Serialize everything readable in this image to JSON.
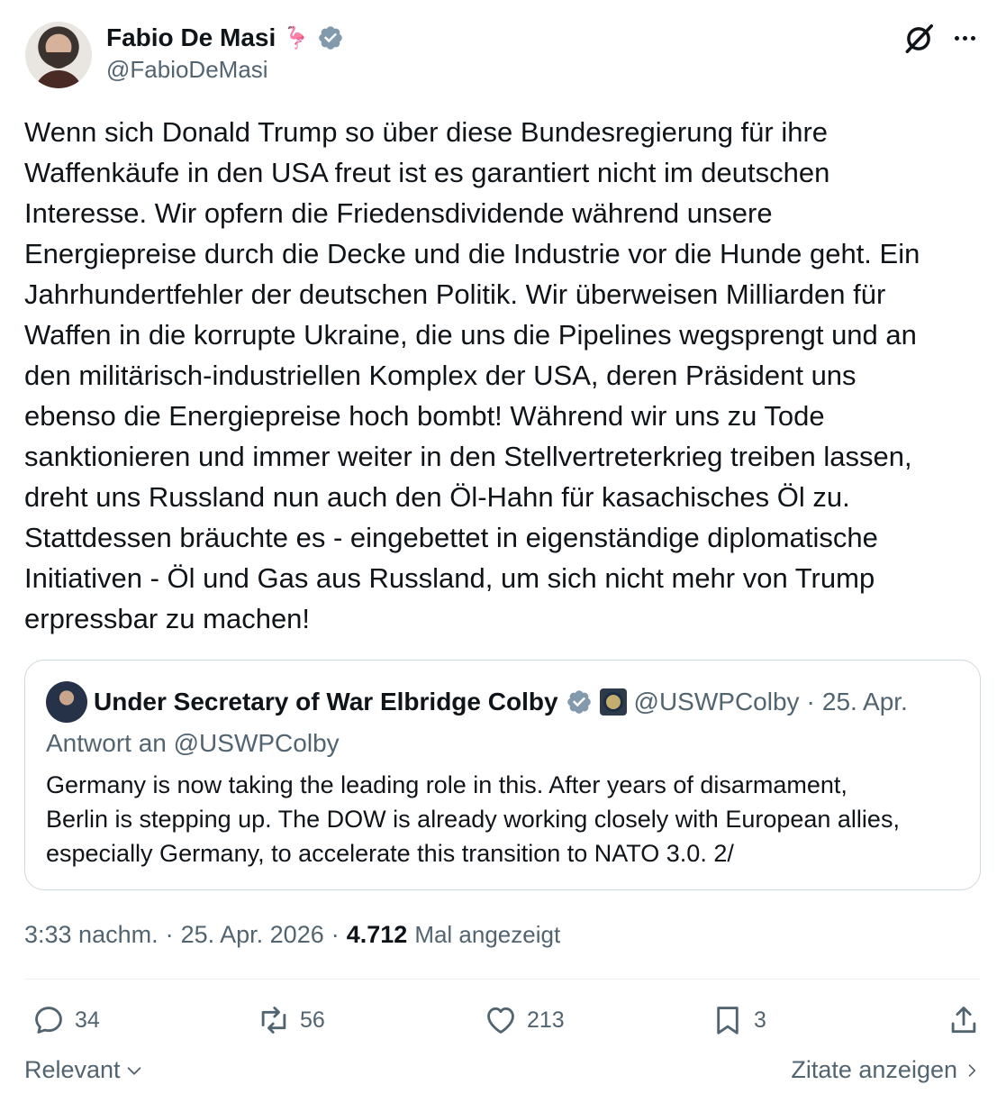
{
  "author": {
    "name": "Fabio De Masi",
    "emoji": "🦩",
    "handle": "@FabioDeMasi"
  },
  "tweet": {
    "text": "Wenn sich Donald Trump so über diese Bundesregierung für ihre\nWaffenkäufe in den USA freut ist es garantiert nicht im deutschen\nInteresse. Wir opfern die Friedensdividende während unsere\nEnergiepreise durch die Decke und die Industrie vor die Hunde geht. Ein\nJahrhundertfehler der deutschen Politik. Wir überweisen Milliarden für\nWaffen in die korrupte Ukraine, die uns die Pipelines wegsprengt und an\nden militärisch-industriellen Komplex der USA, deren Präsident uns\nebenso die Energiepreise hoch bombt! Während wir uns zu Tode\nsanktionieren und immer weiter in den Stellvertreterkrieg treiben lassen,\ndreht uns Russland nun auch den Öl-Hahn für kasachisches Öl zu.\nStattdessen bräuchte es - eingebettet in eigenständige diplomatische\nInitiativen - Öl und Gas aus Russland, um sich nicht mehr von Trump\nerpressbar zu machen!"
  },
  "quote": {
    "name": "Under Secretary of War Elbridge Colby",
    "handle": "@USWPColby",
    "separator": "·",
    "date": "25. Apr.",
    "reply_to": "Antwort an @USWPColby",
    "text": "Germany is now taking the leading role in this. After years of disarmament,\nBerlin is stepping up. The DOW is already working closely with European allies,\nespecially Germany, to accelerate this transition to NATO 3.0. 2/"
  },
  "meta": {
    "time": "3:33 nachm.",
    "separator": "·",
    "date": "25. Apr. 2026",
    "views_count": "4.712",
    "views_label": "Mal angezeigt"
  },
  "actions": {
    "replies": "34",
    "reposts": "56",
    "likes": "213",
    "bookmarks": "3"
  },
  "footer": {
    "sort_label": "Relevant",
    "quotes_label": "Zitate anzeigen"
  },
  "colors": {
    "text": "#0f1419",
    "secondary": "#536471",
    "border": "#cfd9de",
    "verified": "#829aab"
  }
}
